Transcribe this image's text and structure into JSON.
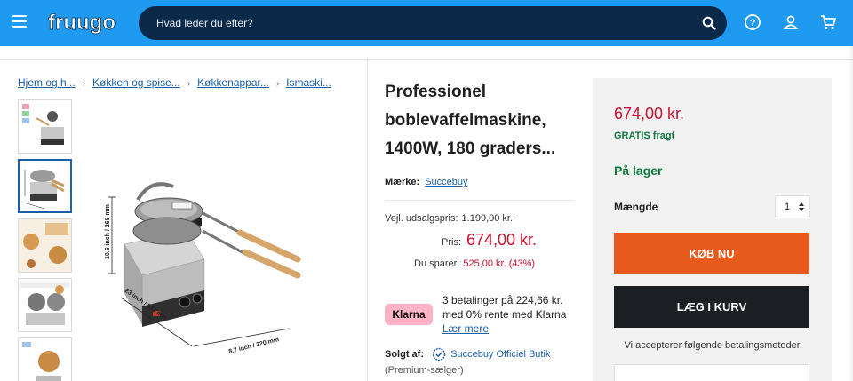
{
  "header": {
    "logo_text": "fruugo",
    "search_placeholder": "Hvad leder du efter?",
    "colors": {
      "bar": "#1e9bf0",
      "search_bg": "#0b2a4a"
    }
  },
  "breadcrumb": [
    "Hjem og h...",
    "Køkken og spise...",
    "Køkkenappar...",
    "Ismaski..."
  ],
  "image": {
    "dim_height": "10.6 inch / 268 mm",
    "dim_depth": "23 inch / 583 mm",
    "dim_width": "8.7 inch / 220 mm"
  },
  "product": {
    "title_lines": [
      "Professionel",
      "boblevaffelmaskine,",
      "1400W, 180 graders..."
    ],
    "brand_label": "Mærke:",
    "brand_value": "Succebuy",
    "rrp_label": "Vejl. udsalgspris:",
    "rrp_value": "1.199,00 kr.",
    "price_label": "Pris:",
    "price_value": "674,00 kr.",
    "save_label": "Du sparer:",
    "save_value": "525,00 kr. (43%)",
    "klarna_badge": "Klarna",
    "klarna_line1": "3 betalinger på 224,66 kr.",
    "klarna_line2": "med 0% rente med Klarna",
    "klarna_link": "Lær mere",
    "seller_label": "Solgt af:",
    "seller_name": "Succebuy Officiel Butik",
    "seller_sub": "(Premium-sælger)"
  },
  "panel": {
    "price": "674,00 kr.",
    "shipping": "GRATIS fragt",
    "stock": "På lager",
    "qty_label": "Mængde",
    "qty_value": "1",
    "buy_now": "KØB NU",
    "add_to_cart": "LÆG I KURV",
    "payment_text": "Vi accepterer følgende betalingsmetoder",
    "colors": {
      "buy": "#e85a1b",
      "cart": "#1b1f24",
      "price": "#c8102e",
      "stock": "#0f7a3d"
    }
  }
}
